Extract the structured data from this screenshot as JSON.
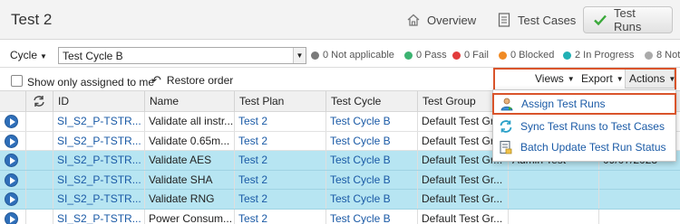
{
  "header": {
    "title": "Test 2",
    "tabs": [
      {
        "label": "Overview"
      },
      {
        "label": "Test Cases"
      },
      {
        "label": "Test Runs"
      }
    ]
  },
  "filter": {
    "cycle_label": "Cycle",
    "cycle_value": "Test Cycle B",
    "stats": [
      {
        "label": "0 Not applicable",
        "color": "#7a7a7a"
      },
      {
        "label": "0 Pass",
        "color": "#3cb371"
      },
      {
        "label": "0 Fail",
        "color": "#e23b3b"
      },
      {
        "label": "0 Blocked",
        "color": "#f08a24"
      },
      {
        "label": "2 In Progress",
        "color": "#21b0b4"
      },
      {
        "label": "8 Not",
        "color": "#aaaaaa"
      }
    ]
  },
  "toolbar": {
    "show_only_label": "Show only assigned to me",
    "restore_label": "Restore order",
    "views_label": "Views",
    "export_label": "Export",
    "actions_label": "Actions"
  },
  "grid": {
    "columns": [
      "ID",
      "Name",
      "Test Plan",
      "Test Cycle",
      "Test Group"
    ],
    "rows": [
      {
        "id": "SI_S2_P-TSTR...",
        "name": "Validate all instr...",
        "plan": "Test 2",
        "cycle": "Test Cycle B",
        "group": "Default Test Gr...",
        "extra1": "",
        "extra2": "",
        "selected": false
      },
      {
        "id": "SI_S2_P-TSTR...",
        "name": "Validate 0.65m...",
        "plan": "Test 2",
        "cycle": "Test Cycle B",
        "group": "Default Test Gr...",
        "extra1": "",
        "extra2": "",
        "selected": false
      },
      {
        "id": "SI_S2_P-TSTR...",
        "name": "Validate AES",
        "plan": "Test 2",
        "cycle": "Test Cycle B",
        "group": "Default Test Gr...",
        "extra1": "Admin Test",
        "extra2": "09/07/2023",
        "selected": true
      },
      {
        "id": "SI_S2_P-TSTR...",
        "name": "Validate SHA",
        "plan": "Test 2",
        "cycle": "Test Cycle B",
        "group": "Default Test Gr...",
        "extra1": "",
        "extra2": "",
        "selected": true
      },
      {
        "id": "SI_S2_P-TSTR...",
        "name": "Validate RNG",
        "plan": "Test 2",
        "cycle": "Test Cycle B",
        "group": "Default Test Gr...",
        "extra1": "",
        "extra2": "",
        "selected": true
      },
      {
        "id": "SI_S2_P-TSTR...",
        "name": "Power Consum...",
        "plan": "Test 2",
        "cycle": "Test Cycle B",
        "group": "Default Test Gr...",
        "extra1": "",
        "extra2": "",
        "selected": false
      }
    ]
  },
  "actions_menu": {
    "items": [
      {
        "label": "Assign Test Runs",
        "icon": "assign-user-icon"
      },
      {
        "label": "Sync Test Runs to Test Cases",
        "icon": "sync-icon"
      },
      {
        "label": "Batch Update Test Run Status",
        "icon": "batch-update-icon"
      }
    ]
  },
  "colors": {
    "accent": "#1a5aa6",
    "selected_row": "#b7e5f2",
    "highlight": "#d9542b"
  }
}
